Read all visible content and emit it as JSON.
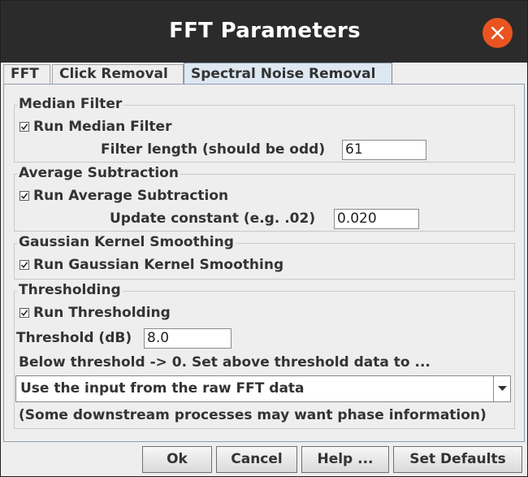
{
  "window": {
    "title": "FFT Parameters"
  },
  "tabs": [
    {
      "label": "FFT",
      "active": false
    },
    {
      "label": "Click Removal",
      "active": false
    },
    {
      "label": "Spectral Noise Removal",
      "active": true
    }
  ],
  "median": {
    "legend": "Median Filter",
    "checkbox_label": "Run Median Filter",
    "checked": true,
    "length_label": "Filter length (should be odd)",
    "length_value": "61"
  },
  "average": {
    "legend": "Average Subtraction",
    "checkbox_label": "Run Average Subtraction",
    "checked": true,
    "update_label": "Update constant (e.g. .02)",
    "update_value": "0.020"
  },
  "gaussian": {
    "legend": "Gaussian Kernel Smoothing",
    "checkbox_label": "Run Gaussian Kernel Smoothing",
    "checked": true
  },
  "threshold": {
    "legend": "Thresholding",
    "checkbox_label": "Run Thresholding",
    "checked": true,
    "db_label": "Threshold (dB)",
    "db_value": "8.0",
    "below_text": "Below threshold -> 0. Set above threshold data to ...",
    "combo_value": "Use the input from the raw FFT data",
    "note": "(Some downstream processes may want phase information)"
  },
  "buttons": {
    "ok": "Ok",
    "cancel": "Cancel",
    "help": "Help ...",
    "defaults": "Set Defaults"
  },
  "colors": {
    "titlebar": "#2b2b2b",
    "close_button": "#e95420",
    "active_tab": "#dde8f3",
    "panel": "#eeeeee"
  }
}
